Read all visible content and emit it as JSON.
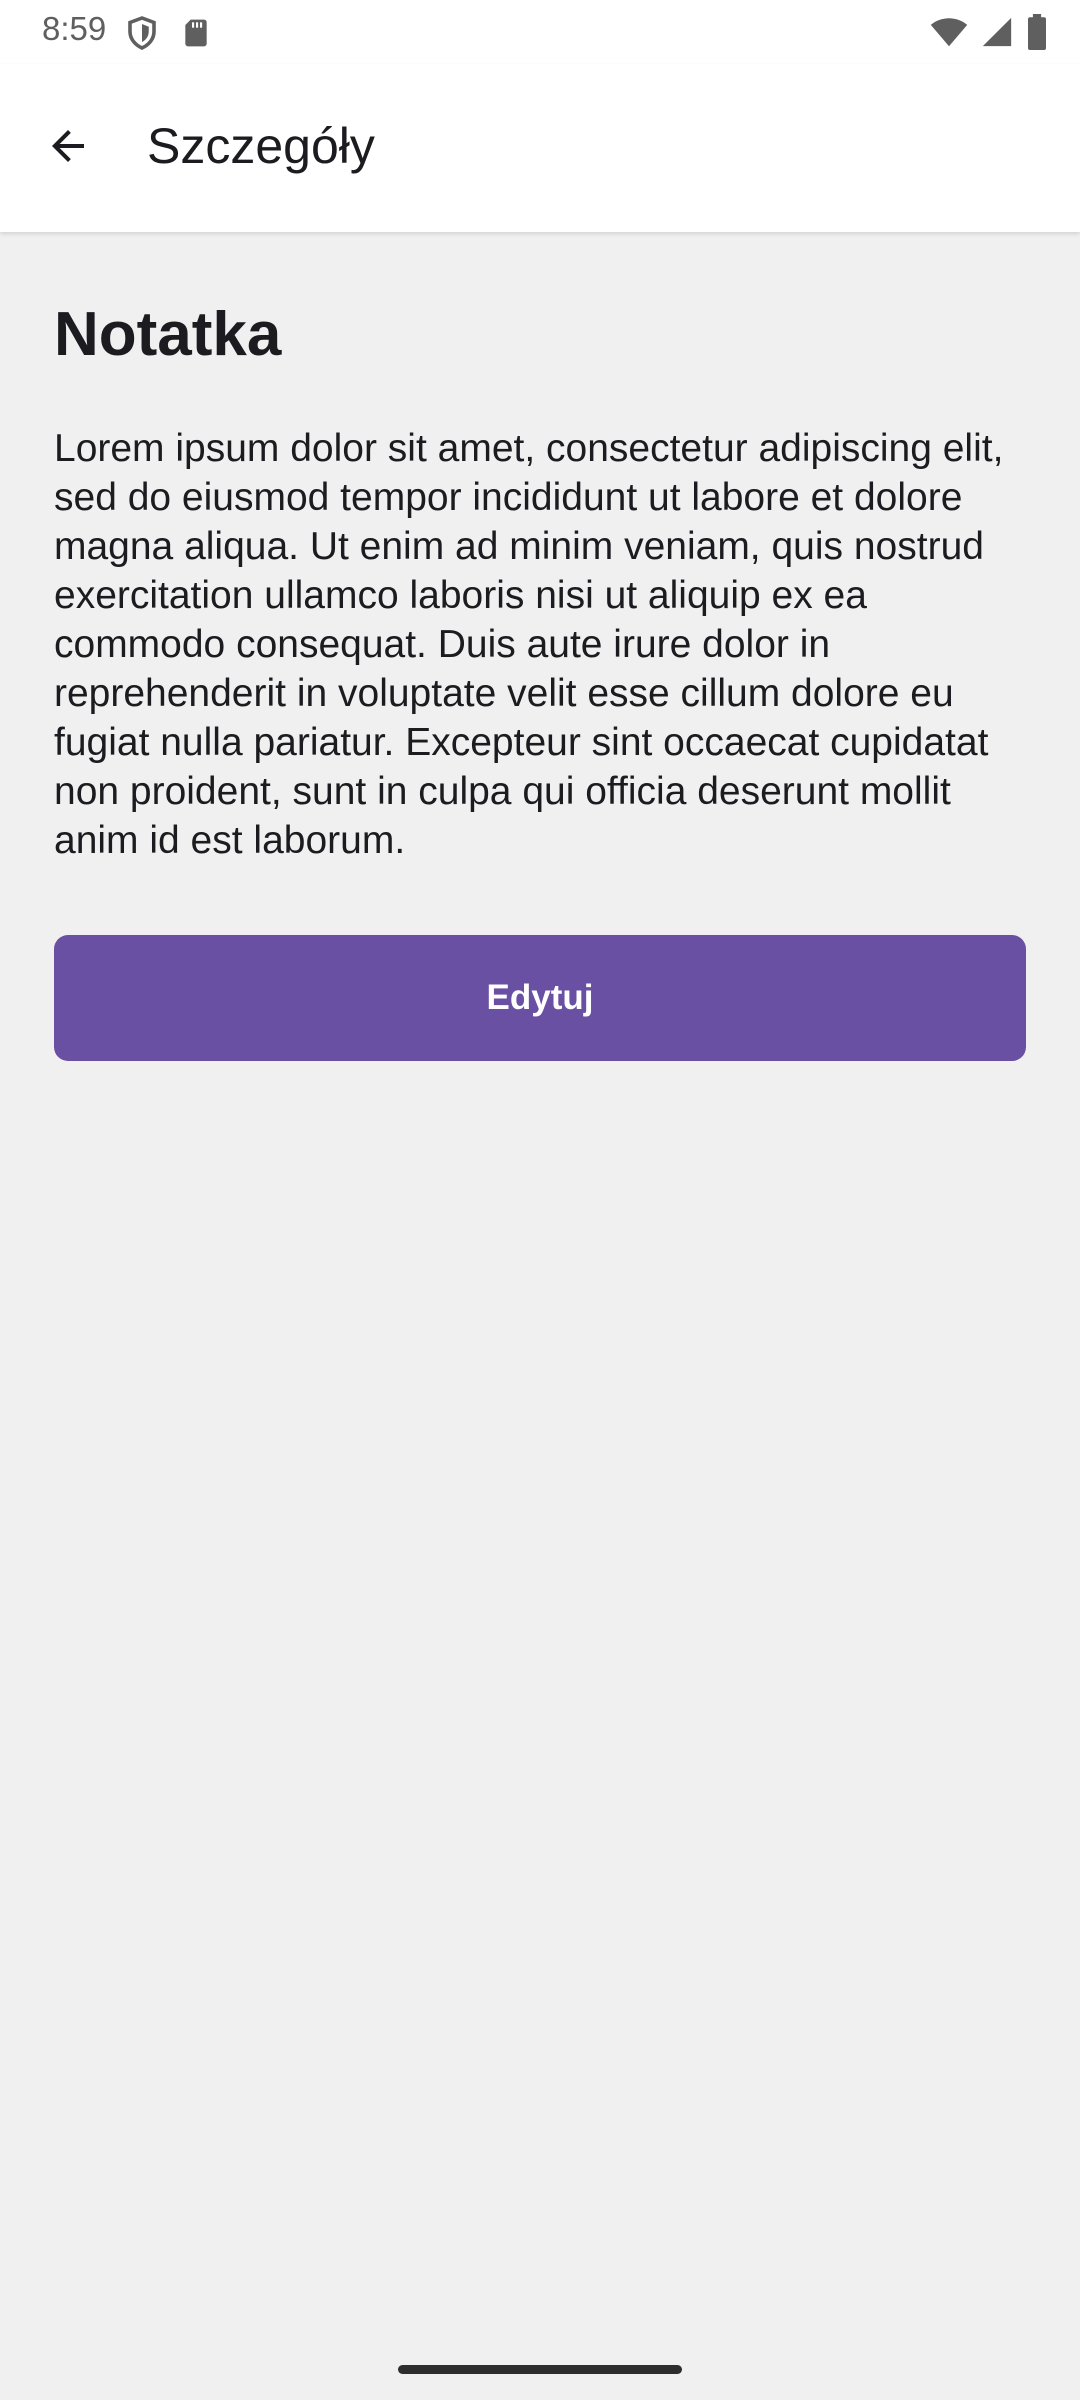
{
  "status_bar": {
    "time": "8:59",
    "left_icons": [
      "shield-icon",
      "sd-card-icon"
    ],
    "right_icons": [
      "wifi-icon",
      "cell-signal-icon",
      "battery-icon"
    ]
  },
  "app_bar": {
    "title": "Szczegóły",
    "back_icon": "arrow-back-icon"
  },
  "note": {
    "title": "Notatka",
    "body": "Lorem ipsum dolor sit amet, consectetur adipiscing elit, sed do eiusmod tempor incididunt ut labore et dolore magna aliqua. Ut enim ad minim veniam, quis nostrud exercitation ullamco laboris nisi ut aliquip ex ea commodo consequat. Duis aute irure dolor in reprehenderit in voluptate velit esse cillum dolore eu fugiat nulla pariatur. Excepteur sint occaecat cupidatat non proident, sunt in culpa qui officia deserunt mollit anim id est laborum."
  },
  "actions": {
    "edit_label": "Edytuj"
  },
  "colors": {
    "accent": "#6a50a3",
    "background": "#f1f0f1",
    "surface": "#ffffff",
    "text": "#1c1b1f"
  }
}
